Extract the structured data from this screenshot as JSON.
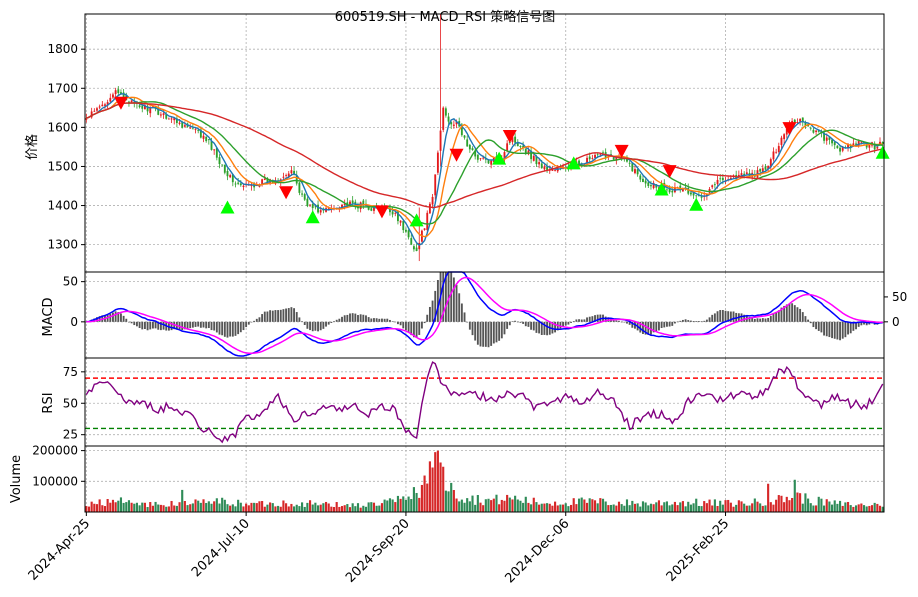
{
  "figure": {
    "title": "600519.SH - MACD_RSI 策略信号图"
  },
  "colors": {
    "up": "#e41a1c",
    "down": "#2ca02c",
    "ma_short": "#1f77b4",
    "ma_mid": "#ff7f0e",
    "ma_long1": "#2ca02c",
    "ma_long2": "#d62728",
    "buy_signal": "#00ff00",
    "sell_signal": "#ff0000",
    "macd_line": "#0000ff",
    "signal_line": "#ff00ff",
    "hist": "#555555",
    "rsi": "#800080",
    "rsi_high": "#ff0000",
    "rsi_low": "#008000",
    "vol_up": "#d62728",
    "vol_down": "#2e8b57"
  },
  "chart_data": [
    {
      "type": "candlestick",
      "ylabel": "价格",
      "ylim": [
        1230,
        1890
      ],
      "yticks": [
        1300,
        1400,
        1500,
        1600,
        1700,
        1800
      ],
      "grid": true,
      "price_anchors": [
        [
          0,
          1622
        ],
        [
          5,
          1650
        ],
        [
          10,
          1688
        ],
        [
          14,
          1680
        ],
        [
          18,
          1655
        ],
        [
          24,
          1648
        ],
        [
          30,
          1630
        ],
        [
          36,
          1608
        ],
        [
          42,
          1585
        ],
        [
          46,
          1560
        ],
        [
          50,
          1515
        ],
        [
          54,
          1470
        ],
        [
          58,
          1448
        ],
        [
          62,
          1452
        ],
        [
          66,
          1460
        ],
        [
          70,
          1462
        ],
        [
          74,
          1480
        ],
        [
          78,
          1482
        ],
        [
          80,
          1435
        ],
        [
          84,
          1398
        ],
        [
          88,
          1385
        ],
        [
          92,
          1392
        ],
        [
          96,
          1405
        ],
        [
          100,
          1400
        ],
        [
          104,
          1400
        ],
        [
          108,
          1392
        ],
        [
          112,
          1390
        ],
        [
          116,
          1382
        ],
        [
          119,
          1340
        ],
        [
          122,
          1308
        ],
        [
          124,
          1283
        ],
        [
          127,
          1350
        ],
        [
          130,
          1420
        ],
        [
          134,
          1650
        ],
        [
          136,
          1620
        ],
        [
          140,
          1600
        ],
        [
          144,
          1540
        ],
        [
          148,
          1520
        ],
        [
          152,
          1510
        ],
        [
          156,
          1525
        ],
        [
          158,
          1560
        ],
        [
          160,
          1570
        ],
        [
          164,
          1550
        ],
        [
          168,
          1520
        ],
        [
          172,
          1495
        ],
        [
          176,
          1492
        ],
        [
          180,
          1498
        ],
        [
          184,
          1505
        ],
        [
          188,
          1515
        ],
        [
          192,
          1525
        ],
        [
          196,
          1530
        ],
        [
          200,
          1522
        ],
        [
          204,
          1505
        ],
        [
          208,
          1470
        ],
        [
          212,
          1455
        ],
        [
          216,
          1452
        ],
        [
          220,
          1440
        ],
        [
          224,
          1445
        ],
        [
          228,
          1420
        ],
        [
          232,
          1432
        ],
        [
          236,
          1458
        ],
        [
          240,
          1470
        ],
        [
          244,
          1475
        ],
        [
          248,
          1478
        ],
        [
          252,
          1482
        ],
        [
          256,
          1500
        ],
        [
          260,
          1560
        ],
        [
          264,
          1612
        ],
        [
          268,
          1620
        ],
        [
          272,
          1598
        ],
        [
          276,
          1580
        ],
        [
          280,
          1555
        ],
        [
          284,
          1542
        ],
        [
          288,
          1556
        ],
        [
          292,
          1558
        ],
        [
          296,
          1552
        ],
        [
          299,
          1565
        ]
      ],
      "spikes": [
        {
          "i": 133,
          "high": 1890,
          "low": 1500
        },
        {
          "i": 125,
          "high": 1395,
          "low": 1258
        }
      ],
      "ma_lines": [
        {
          "key": "ma_short",
          "window": 5
        },
        {
          "key": "ma_mid",
          "window": 10
        },
        {
          "key": "ma_long1",
          "window": 20
        },
        {
          "key": "ma_long2",
          "window": 60
        }
      ],
      "buy_signals": [
        {
          "i": 53,
          "price": 1395
        },
        {
          "i": 85,
          "price": 1370
        },
        {
          "i": 124,
          "price": 1362
        },
        {
          "i": 155,
          "price": 1520
        },
        {
          "i": 183,
          "price": 1508
        },
        {
          "i": 216,
          "price": 1441
        },
        {
          "i": 229,
          "price": 1402
        },
        {
          "i": 299,
          "price": 1535
        }
      ],
      "sell_signals": [
        {
          "i": 13,
          "price": 1663
        },
        {
          "i": 75,
          "price": 1434
        },
        {
          "i": 111,
          "price": 1385
        },
        {
          "i": 139,
          "price": 1530
        },
        {
          "i": 159,
          "price": 1578
        },
        {
          "i": 201,
          "price": 1540
        },
        {
          "i": 219,
          "price": 1488
        },
        {
          "i": 264,
          "price": 1598
        }
      ]
    },
    {
      "type": "line",
      "ylabel": "MACD",
      "ylim": [
        -45,
        62
      ],
      "yticks": [
        0,
        50
      ],
      "right_yticks": [
        "0",
        "50"
      ],
      "series": [
        {
          "name": "",
          "color_key": "macd_line"
        },
        {
          "name": "",
          "color_key": "signal_line"
        },
        {
          "name": "",
          "color_key": "hist",
          "style": "bar"
        }
      ]
    },
    {
      "type": "line",
      "ylabel": "RSI",
      "ylim": [
        16,
        86
      ],
      "yticks": [
        25,
        50,
        75
      ],
      "overbought": 70,
      "oversold": 30,
      "rsi_anchors": [
        [
          0,
          55
        ],
        [
          5,
          70
        ],
        [
          10,
          65
        ],
        [
          14,
          50
        ],
        [
          20,
          52
        ],
        [
          26,
          45
        ],
        [
          32,
          48
        ],
        [
          38,
          42
        ],
        [
          44,
          30
        ],
        [
          50,
          22
        ],
        [
          56,
          25
        ],
        [
          60,
          38
        ],
        [
          66,
          42
        ],
        [
          72,
          55
        ],
        [
          78,
          38
        ],
        [
          84,
          42
        ],
        [
          90,
          48
        ],
        [
          96,
          45
        ],
        [
          100,
          50
        ],
        [
          106,
          42
        ],
        [
          112,
          48
        ],
        [
          116,
          44
        ],
        [
          120,
          28
        ],
        [
          124,
          25
        ],
        [
          128,
          72
        ],
        [
          130,
          84
        ],
        [
          134,
          62
        ],
        [
          140,
          55
        ],
        [
          146,
          58
        ],
        [
          152,
          52
        ],
        [
          158,
          60
        ],
        [
          164,
          55
        ],
        [
          168,
          48
        ],
        [
          174,
          52
        ],
        [
          180,
          55
        ],
        [
          186,
          50
        ],
        [
          192,
          58
        ],
        [
          198,
          52
        ],
        [
          204,
          32
        ],
        [
          210,
          40
        ],
        [
          216,
          42
        ],
        [
          222,
          35
        ],
        [
          226,
          52
        ],
        [
          232,
          58
        ],
        [
          238,
          52
        ],
        [
          244,
          58
        ],
        [
          250,
          55
        ],
        [
          256,
          60
        ],
        [
          260,
          75
        ],
        [
          264,
          78
        ],
        [
          268,
          60
        ],
        [
          272,
          55
        ],
        [
          276,
          48
        ],
        [
          280,
          56
        ],
        [
          286,
          50
        ],
        [
          292,
          48
        ],
        [
          296,
          52
        ],
        [
          299,
          63
        ]
      ]
    },
    {
      "type": "bar",
      "ylabel": "Volume",
      "ylim": [
        0,
        215000
      ],
      "yticks": [
        100000,
        200000
      ],
      "x_tick_labels": [
        "2024-Apr-25",
        "2024-Jul-10",
        "2024-Sep-20",
        "2024-Dec-06",
        "2025-Feb-25"
      ],
      "x_tick_index": [
        0,
        60,
        120,
        180,
        240
      ],
      "volume_anchors": [
        [
          0,
          28000
        ],
        [
          10,
          38000
        ],
        [
          20,
          26000
        ],
        [
          30,
          24000
        ],
        [
          40,
          30000
        ],
        [
          50,
          35000
        ],
        [
          60,
          26000
        ],
        [
          70,
          28000
        ],
        [
          80,
          30000
        ],
        [
          90,
          24000
        ],
        [
          100,
          22000
        ],
        [
          110,
          26000
        ],
        [
          118,
          40000
        ],
        [
          124,
          65000
        ],
        [
          128,
          120000
        ],
        [
          132,
          150000
        ],
        [
          136,
          85000
        ],
        [
          140,
          55000
        ],
        [
          146,
          42000
        ],
        [
          152,
          38000
        ],
        [
          160,
          45000
        ],
        [
          170,
          30000
        ],
        [
          180,
          32000
        ],
        [
          190,
          34000
        ],
        [
          200,
          30000
        ],
        [
          210,
          28000
        ],
        [
          220,
          32000
        ],
        [
          230,
          30000
        ],
        [
          240,
          28000
        ],
        [
          250,
          30000
        ],
        [
          260,
          40000
        ],
        [
          266,
          55000
        ],
        [
          272,
          38000
        ],
        [
          280,
          28000
        ],
        [
          290,
          22000
        ],
        [
          299,
          26000
        ]
      ],
      "volume_spikes": [
        {
          "i": 129,
          "v": 165000
        },
        {
          "i": 131,
          "v": 195000
        },
        {
          "i": 130,
          "v": 145000
        },
        {
          "i": 266,
          "v": 105000
        },
        {
          "i": 256,
          "v": 92000
        },
        {
          "i": 36,
          "v": 72000
        }
      ]
    }
  ],
  "n_bars": 300
}
